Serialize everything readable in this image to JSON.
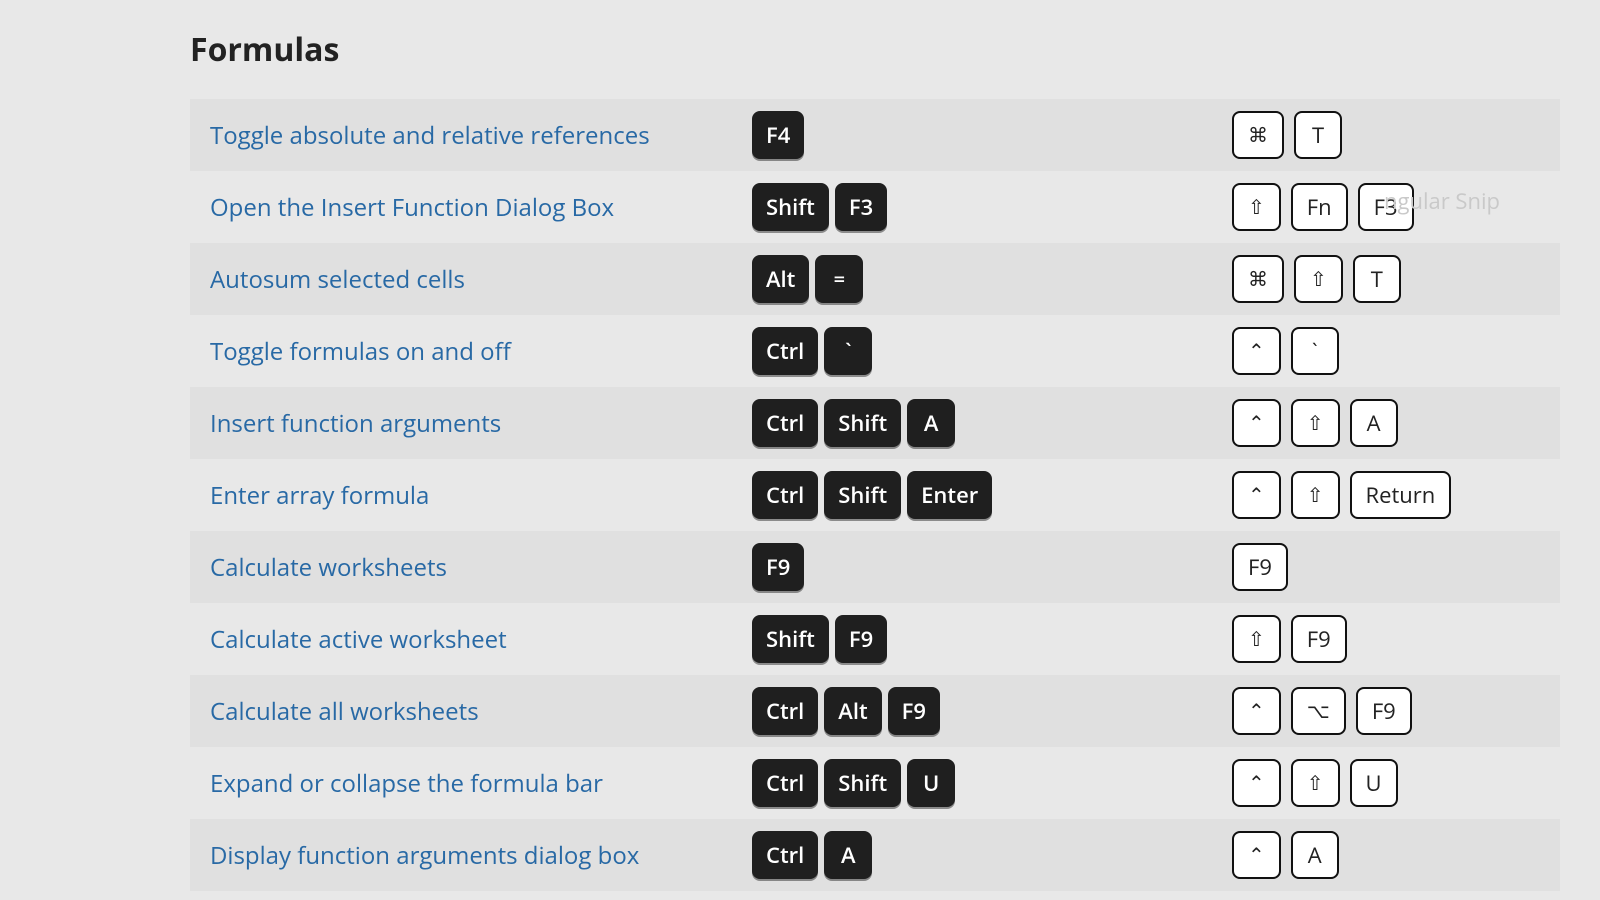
{
  "section_title": "Formulas",
  "ghost_text": "ngular Snip",
  "rows": [
    {
      "desc": "Toggle absolute and relative references",
      "win": [
        "F4"
      ],
      "mac": [
        "⌘",
        "T"
      ]
    },
    {
      "desc": "Open the Insert Function Dialog Box",
      "win": [
        "Shift",
        "F3"
      ],
      "mac": [
        "⇧",
        "Fn",
        "F3"
      ]
    },
    {
      "desc": "Autosum selected cells",
      "win": [
        "Alt",
        "="
      ],
      "mac": [
        "⌘",
        "⇧",
        "T"
      ]
    },
    {
      "desc": "Toggle formulas on and off",
      "win": [
        "Ctrl",
        "`"
      ],
      "mac": [
        "⌃",
        "`"
      ]
    },
    {
      "desc": "Insert function arguments",
      "win": [
        "Ctrl",
        "Shift",
        "A"
      ],
      "mac": [
        "⌃",
        "⇧",
        "A"
      ]
    },
    {
      "desc": "Enter array formula",
      "win": [
        "Ctrl",
        "Shift",
        "Enter"
      ],
      "mac": [
        "⌃",
        "⇧",
        "Return"
      ]
    },
    {
      "desc": "Calculate worksheets",
      "win": [
        "F9"
      ],
      "mac": [
        "F9"
      ]
    },
    {
      "desc": "Calculate active worksheet",
      "win": [
        "Shift",
        "F9"
      ],
      "mac": [
        "⇧",
        "F9"
      ]
    },
    {
      "desc": "Calculate all worksheets",
      "win": [
        "Ctrl",
        "Alt",
        "F9"
      ],
      "mac": [
        "⌃",
        "⌥",
        "F9"
      ]
    },
    {
      "desc": "Expand or collapse the formula bar",
      "win": [
        "Ctrl",
        "Shift",
        "U"
      ],
      "mac": [
        "⌃",
        "⇧",
        "U"
      ]
    },
    {
      "desc": "Display function arguments dialog box",
      "win": [
        "Ctrl",
        "A"
      ],
      "mac": [
        "⌃",
        "A"
      ]
    }
  ]
}
